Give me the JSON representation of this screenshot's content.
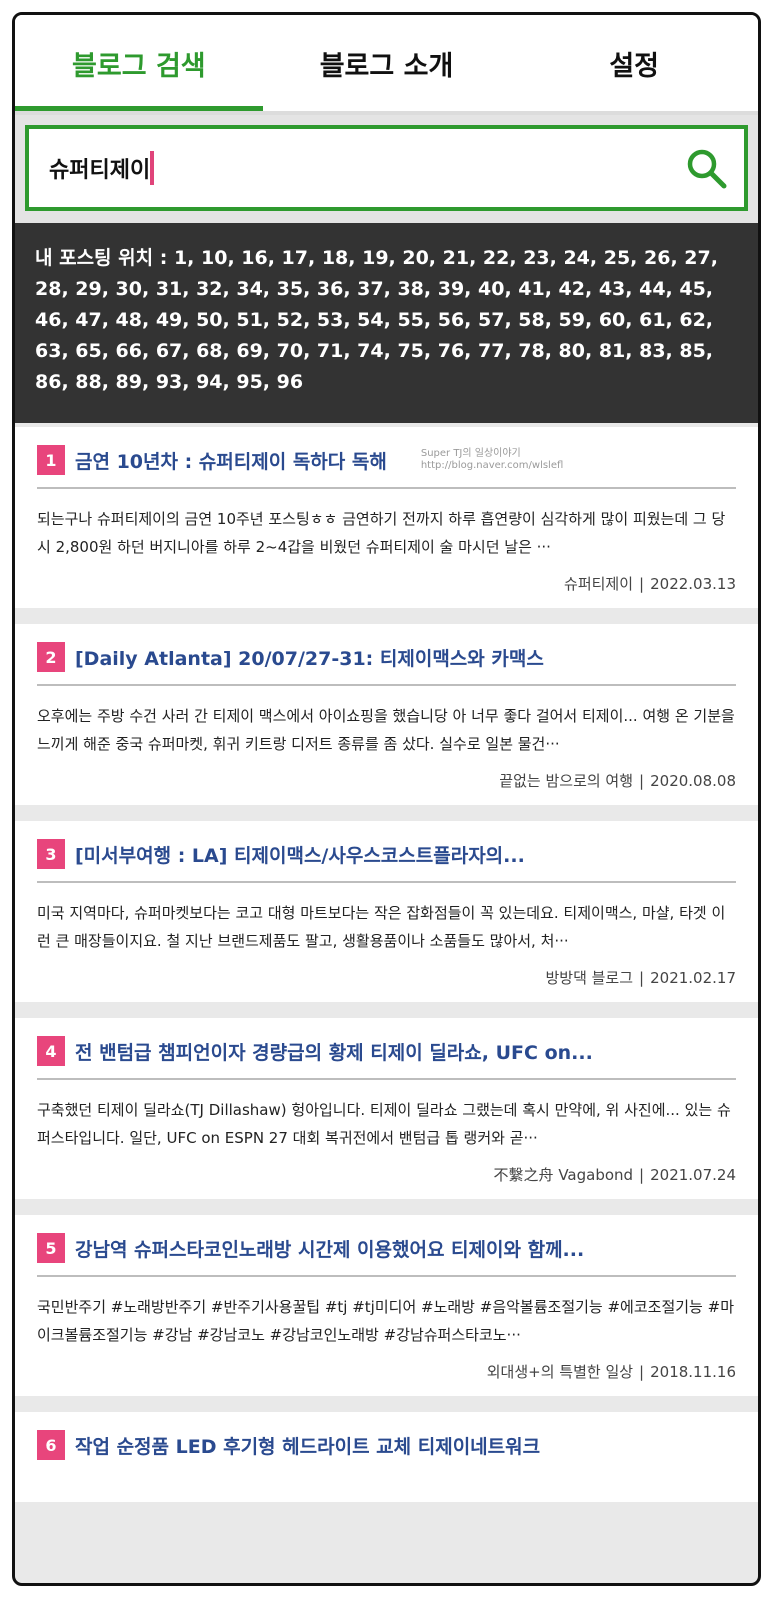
{
  "tabs": [
    {
      "label": "블로그 검색",
      "active": true
    },
    {
      "label": "블로그 소개",
      "active": false
    },
    {
      "label": "설정",
      "active": false
    }
  ],
  "search": {
    "value": "슈퍼티제이",
    "icon": "search-icon"
  },
  "positions": {
    "label": "내 포스팅 위치 :",
    "values": "1, 10, 16, 17, 18, 19, 20, 21, 22, 23, 24, 25, 26, 27, 28, 29, 30, 31, 32, 34, 35, 36, 37, 38, 39, 40, 41, 42, 43, 44, 45, 46, 47, 48, 49, 50, 51, 52, 53, 54, 55, 56, 57, 58, 59, 60, 61, 62, 63, 65, 66, 67, 68, 69, 70, 71, 74, 75, 76, 77, 78, 80, 81, 83, 85, 86, 88, 89, 93, 94, 95, 96"
  },
  "results": [
    {
      "rank": "1",
      "title": "금연 10년차 : 슈퍼티제이 독하다 독해",
      "watermark1": "Super TJ의 일상이야기",
      "watermark2": "http://blog.naver.com/wlslefl",
      "body": "되는구나 슈퍼티제이의 금연 10주년 포스팅ㅎㅎ 금연하기 전까지 하루 흡연량이 심각하게 많이 피웠는데 그 당시 2,800원 하던 버지니아를 하루 2~4갑을 비웠던 슈퍼티제이 술 마시던 날은 ···",
      "author": "슈퍼티제이",
      "date": "2022.03.13"
    },
    {
      "rank": "2",
      "title": "[Daily Atlanta] 20/07/27-31: 티제이맥스와 카맥스",
      "body": "오후에는 주방 수건 사러 간 티제이 맥스에서 아이쇼핑을 했습니당 아 너무 좋다 걸어서 티제이... 여행 온 기분을 느끼게 해준 중국 슈퍼마켓, 휘귀 키트랑 디저트 종류를 좀 샀다. 실수로 일본 물건···",
      "author": "끝없는 밤으로의 여행",
      "date": "2020.08.08"
    },
    {
      "rank": "3",
      "title": "[미서부여행 : LA] 티제이맥스/사우스코스트플라자의...",
      "body": "미국 지역마다, 슈퍼마켓보다는 코고 대형 마트보다는 작은 잡화점들이 꼭 있는데요. 티제이맥스, 마샬, 타겟 이런 큰 매장들이지요. 철 지난 브랜드제품도 팔고, 생활용품이나 소품들도 많아서, 처···",
      "author": "방방댁 블로그",
      "date": "2021.02.17"
    },
    {
      "rank": "4",
      "title": "전 밴텀급 챔피언이자 경량급의 황제 티제이 딜라쇼, UFC on...",
      "body": "구축했던 티제이 딜라쇼(TJ Dillashaw) 헝아입니다. 티제이 딜라쇼 그랬는데 혹시 만약에, 위 사진에... 있는 슈퍼스타입니다. 일단, UFC on ESPN 27 대회 복귀전에서 밴텀급 톱 랭커와 곧···",
      "author": "不繫之舟 Vagabond",
      "date": "2021.07.24"
    },
    {
      "rank": "5",
      "title": "강남역 슈퍼스타코인노래방 시간제 이용했어요 티제이와 함께...",
      "body": "국민반주기 #노래방반주기 #반주기사용꿀팁 #tj #tj미디어 #노래방 #음악볼륨조절기능 #에코조절기능 #마이크볼륨조절기능 #강남 #강남코노 #강남코인노래방 #강남슈퍼스타코노···",
      "author": "외대생+의 특별한 일상",
      "date": "2018.11.16"
    },
    {
      "rank": "6",
      "title": "작업 순정품 LED 후기형 헤드라이트 교체 티제이네트워크"
    }
  ]
}
